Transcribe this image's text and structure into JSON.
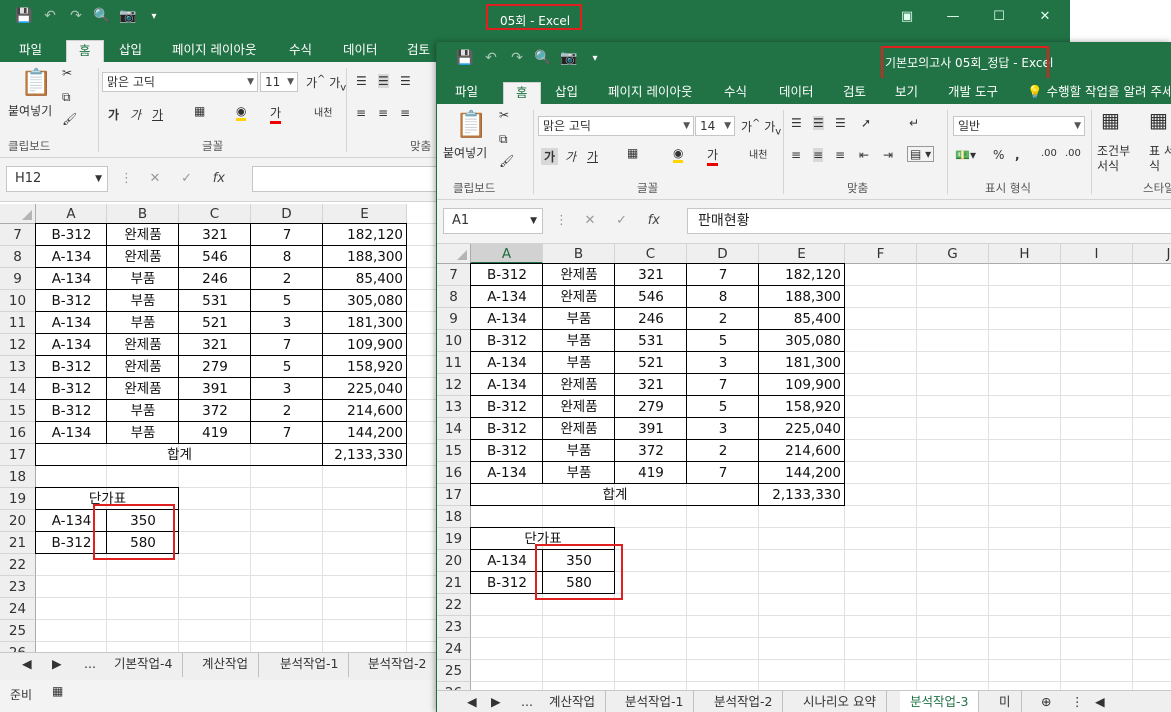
{
  "back_window": {
    "title": "05회 - Excel",
    "qat": [
      "save-icon",
      "undo-icon",
      "redo-icon",
      "print-preview-icon",
      "camera-icon",
      "customize-icon"
    ],
    "tabs": [
      "파일",
      "홈",
      "삽입",
      "페이지 레이아웃",
      "수식",
      "데이터",
      "검토"
    ],
    "active_tab": "홈",
    "ribbon": {
      "paste_label": "붙여넣기",
      "font_name": "맑은 고딕",
      "font_size": "11",
      "group_clipboard": "클립보드",
      "group_font": "글꼴",
      "group_align": "맞춤",
      "bold": "가",
      "italic": "가",
      "underline": "가",
      "wrap": "내천"
    },
    "name_box": "H12",
    "fx": "fx",
    "columns": [
      "A",
      "B",
      "C",
      "D",
      "E"
    ],
    "rows": [
      "7",
      "8",
      "9",
      "10",
      "11",
      "12",
      "13",
      "14",
      "15",
      "16",
      "17",
      "18",
      "19",
      "20",
      "21",
      "22",
      "23",
      "24",
      "25",
      "26"
    ],
    "sheet_tabs": [
      "...",
      "기본작업-4",
      "계산작업",
      "분석작업-1",
      "분석작업-2"
    ],
    "status": "준비"
  },
  "front_window": {
    "title": "기본모의고사 05회_정답 - Excel",
    "tabs": [
      "파일",
      "홈",
      "삽입",
      "페이지 레이아웃",
      "수식",
      "데이터",
      "검토",
      "보기",
      "개발 도구"
    ],
    "tell_me": "수행할 작업을 알려 주세요",
    "active_tab": "홈",
    "ribbon": {
      "paste_label": "붙여넣기",
      "font_name": "맑은 고딕",
      "font_size": "14",
      "number_format": "일반",
      "group_clipboard": "클립보드",
      "group_font": "글꼴",
      "group_align": "맞춤",
      "group_number": "표시 형식",
      "group_style": "스타일",
      "cond_format": "조건부 서식",
      "table_format": "표 서식",
      "bold": "가",
      "italic": "가",
      "underline": "가",
      "wrap": "내천",
      "percent": "%",
      "comma": ","
    },
    "name_box": "A1",
    "fx": "fx",
    "formula_value": "판매현황",
    "columns": [
      "A",
      "B",
      "C",
      "D",
      "E",
      "F",
      "G",
      "H",
      "I",
      "J"
    ],
    "rows": [
      "7",
      "8",
      "9",
      "10",
      "11",
      "12",
      "13",
      "14",
      "15",
      "16",
      "17",
      "18",
      "19",
      "20",
      "21",
      "22",
      "23",
      "24",
      "25",
      "26"
    ],
    "sheet_tabs": [
      "...",
      "계산작업",
      "분석작업-1",
      "분석작업-2",
      "시나리오 요약",
      "분석작업-3",
      "미"
    ],
    "active_sheet": "분석작업-3"
  },
  "table": {
    "rows": [
      [
        "B-312",
        "완제품",
        "321",
        "7",
        "182,120"
      ],
      [
        "A-134",
        "완제품",
        "546",
        "8",
        "188,300"
      ],
      [
        "A-134",
        "부품",
        "246",
        "2",
        "85,400"
      ],
      [
        "B-312",
        "부품",
        "531",
        "5",
        "305,080"
      ],
      [
        "A-134",
        "부품",
        "521",
        "3",
        "181,300"
      ],
      [
        "A-134",
        "완제품",
        "321",
        "7",
        "109,900"
      ],
      [
        "B-312",
        "완제품",
        "279",
        "5",
        "158,920"
      ],
      [
        "B-312",
        "완제품",
        "391",
        "3",
        "225,040"
      ],
      [
        "B-312",
        "부품",
        "372",
        "2",
        "214,600"
      ],
      [
        "A-134",
        "부품",
        "419",
        "7",
        "144,200"
      ]
    ],
    "total_label": "합계",
    "total_value": "2,133,330",
    "price_title": "단가표",
    "price_rows": [
      [
        "A-134",
        "350"
      ],
      [
        "B-312",
        "580"
      ]
    ]
  },
  "colors": {
    "excel_green": "#217346",
    "highlight": "#e0201f"
  }
}
